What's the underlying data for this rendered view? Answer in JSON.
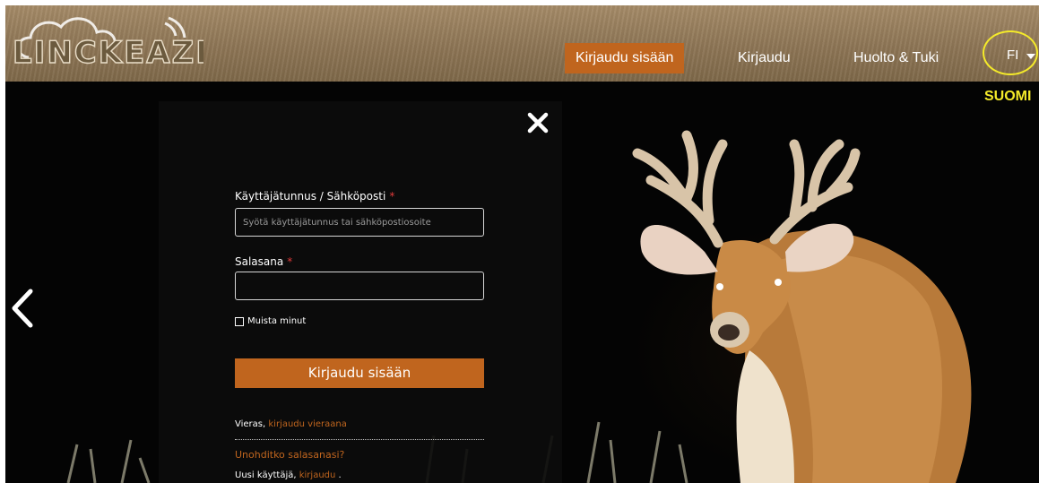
{
  "brand": {
    "logo_text": "LINCKEAZI"
  },
  "nav": {
    "items": [
      {
        "label": "Kirjaudu sisään",
        "active": true
      },
      {
        "label": "Kirjaudu",
        "active": false
      },
      {
        "label": "Huolto & Tuki",
        "active": false
      }
    ],
    "language": {
      "code": "FI",
      "name": "SUOMI"
    }
  },
  "login": {
    "username_label": "Käyttäjätunnus / Sähköposti",
    "username_placeholder": "Syötä käyttäjätunnus tai sähköpostiosoite",
    "username_value": "",
    "password_label": "Salasana",
    "password_value": "",
    "required_marker": "*",
    "remember_label": "Muista minut",
    "remember_checked": false,
    "submit_label": "Kirjaudu sisään",
    "guest_prefix": "Vieras,",
    "guest_link": "kirjaudu vieraana",
    "forgot_link": "Unohditko salasanasi?",
    "new_user_prefix": "Uusi käyttäjä,",
    "new_user_link": "kirjaudu",
    "new_user_suffix": "."
  },
  "colors": {
    "accent": "#c0651e",
    "highlight": "#f4ea2a",
    "required": "#e03a3a"
  },
  "icons": {
    "close": "close-icon",
    "prev": "chevron-left-icon",
    "caret": "caret-down-icon",
    "logo_cloud": "cloud-icon"
  }
}
